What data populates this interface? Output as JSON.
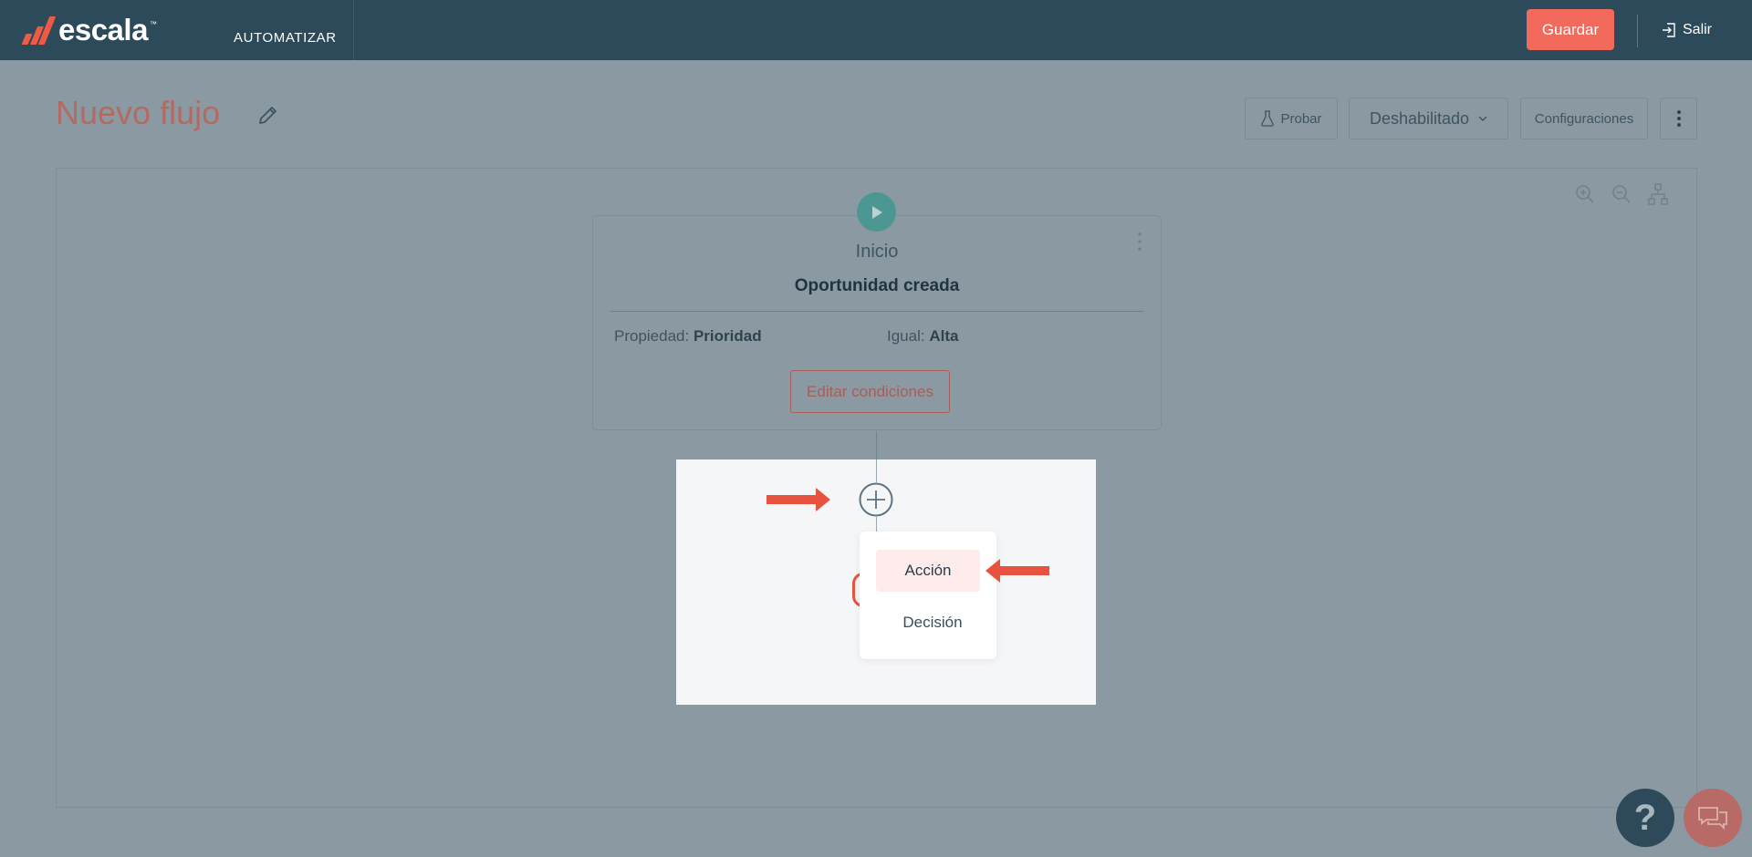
{
  "topbar": {
    "logo_text": "escala",
    "logo_tm": "™",
    "nav_label": "AUTOMATIZAR",
    "save_label": "Guardar",
    "exit_label": "Salir"
  },
  "header": {
    "title": "Nuevo flujo",
    "test_label": "Probar",
    "status_label": "Deshabilitado",
    "settings_label": "Configuraciones"
  },
  "start_card": {
    "stage_label": "Inicio",
    "name": "Oportunidad creada",
    "property_label": "Propiedad:",
    "property_value": "Prioridad",
    "condition_label": "Igual:",
    "condition_value": "Alta",
    "edit_label": "Editar condiciones"
  },
  "add_menu": {
    "items": [
      {
        "label": "Acción",
        "active": true
      },
      {
        "label": "Decisión",
        "active": false
      }
    ]
  },
  "help": {
    "label": "?"
  },
  "colors": {
    "topbar": "#2d4a5a",
    "accent": "#f26a5c",
    "arrow": "#e8533f",
    "start_icon": "#4c9794"
  },
  "icons": [
    "pencil-icon",
    "flask-icon",
    "chevron-down-icon",
    "more-vertical-icon",
    "zoom-in-icon",
    "zoom-out-icon",
    "sitemap-icon",
    "play-icon",
    "plus-circle-icon",
    "arrow-right-icon",
    "arrow-left-icon",
    "exit-icon",
    "chat-icon"
  ]
}
